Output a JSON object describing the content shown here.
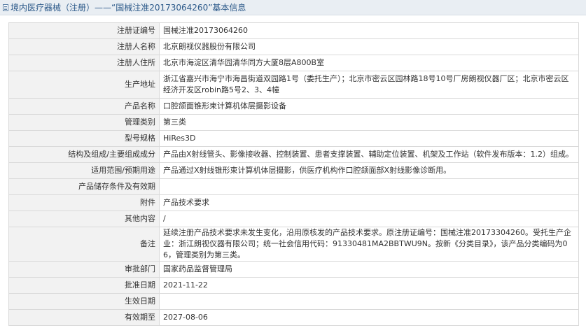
{
  "header": {
    "title": "境内医疗器械（注册）——“国械注准20173064260”基本信息",
    "icon": "document-icon",
    "accent": "#2d5a8a"
  },
  "rows": [
    {
      "label": "注册证编号",
      "value": "国械注准20173064260"
    },
    {
      "label": "注册人名称",
      "value": "北京朗视仪器股份有限公司"
    },
    {
      "label": "注册人住所",
      "value": "北京市海淀区清华园清华同方大厦8层A800B室"
    },
    {
      "label": "生产地址",
      "value": "浙江省嘉兴市海宁市海昌街道双园路1号（委托生产）；北京市密云区园林路18号10号厂房朗视仪器厂区；北京市密云区经济开发区robin路5号2、3、4幢"
    },
    {
      "label": "产品名称",
      "value": "口腔颌面锥形束计算机体层摄影设备"
    },
    {
      "label": "管理类别",
      "value": "第三类"
    },
    {
      "label": "型号规格",
      "value": "HiRes3D"
    },
    {
      "label": "结构及组成/主要组成成分",
      "value": "产品由X射线管头、影像接收器、控制装置、患者支撑装置、辅助定位装置、机架及工作站（软件发布版本：1.2）组成。"
    },
    {
      "label": "适用范围/预期用途",
      "value": "产品通过X射线锥形束计算机体层摄影，供医疗机构作口腔颌面部X射线影像诊断用。"
    },
    {
      "label": "产品储存条件及有效期",
      "value": ""
    },
    {
      "label": "附件",
      "value": "产品技术要求"
    },
    {
      "label": "其他内容",
      "value": "/"
    },
    {
      "label": "备注",
      "value": "延续注册产品技术要求未发生变化，沿用原核发的产品技术要求。原注册证编号：国械注准20173304260。受托生产企业：浙江朗视仪器有限公司；统一社会信用代码：91330481MA2BBTWU9N。按新《分类目录》，该产品分类编码为06，管理类别为第三类。"
    },
    {
      "label": "审批部门",
      "value": "国家药品监督管理局"
    },
    {
      "label": "批准日期",
      "value": "2021-11-22"
    },
    {
      "label": "生效日期",
      "value": ""
    },
    {
      "label": "有效期至",
      "value": "2027-08-06"
    }
  ]
}
